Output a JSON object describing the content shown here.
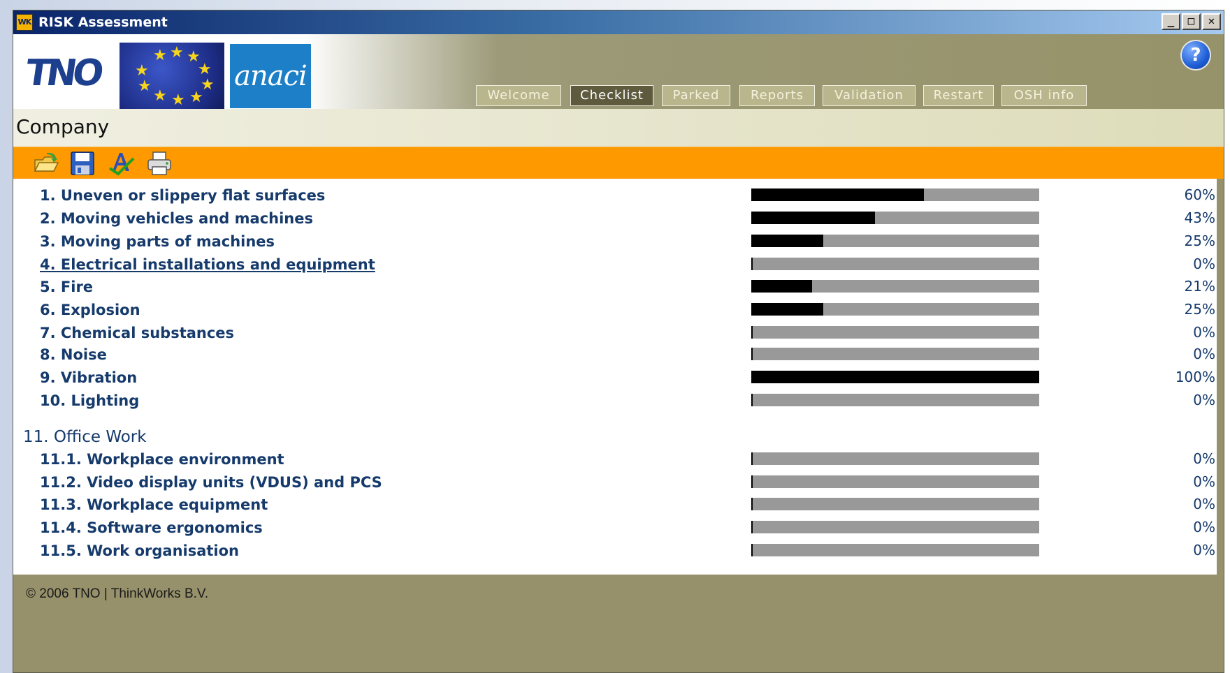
{
  "window": {
    "title": "RISK Assessment",
    "app_icon": "WK",
    "minimize": "_",
    "maximize": "□",
    "close": "✕"
  },
  "banner": {
    "tno_logo_text": "TNO",
    "anaci_logo_text": "anaci",
    "help_label": "?"
  },
  "tabs": [
    {
      "label": "Welcome",
      "active": false
    },
    {
      "label": "Checklist",
      "active": true
    },
    {
      "label": "Parked",
      "active": false
    },
    {
      "label": "Reports",
      "active": false
    },
    {
      "label": "Validation",
      "active": false
    },
    {
      "label": "Restart",
      "active": false
    },
    {
      "label": "OSH info",
      "active": false
    }
  ],
  "page": {
    "title": "Company"
  },
  "toolbar": {
    "icons": [
      "open-folder-icon",
      "save-icon",
      "spell-check-icon",
      "print-icon"
    ]
  },
  "checklist": {
    "items": [
      {
        "label": "1. Uneven or slippery flat surfaces",
        "percent": "60%",
        "progress": 0.6
      },
      {
        "label": "2. Moving vehicles and machines",
        "percent": "43%",
        "progress": 0.43
      },
      {
        "label": "3. Moving parts of machines",
        "percent": "25%",
        "progress": 0.25
      },
      {
        "label": "4. Electrical installations and equipment",
        "percent": "0%",
        "progress": 0,
        "link": true
      },
      {
        "label": "5. Fire",
        "percent": "21%",
        "progress": 0.21
      },
      {
        "label": "6. Explosion",
        "percent": "25%",
        "progress": 0.25
      },
      {
        "label": "7. Chemical substances",
        "percent": "0%",
        "progress": 0
      },
      {
        "label": "8. Noise",
        "percent": "0%",
        "progress": 0
      },
      {
        "label": "9. Vibration",
        "percent": "100%",
        "progress": 1.0
      },
      {
        "label": "10. Lighting",
        "percent": "0%",
        "progress": 0
      }
    ],
    "section_heading": "11. Office Work",
    "sub_items": [
      {
        "label": "11.1. Workplace environment",
        "percent": "0%",
        "progress": 0
      },
      {
        "label": "11.2. Video display units (VDUS) and PCS",
        "percent": "0%",
        "progress": 0
      },
      {
        "label": "11.3. Workplace equipment",
        "percent": "0%",
        "progress": 0
      },
      {
        "label": "11.4. Software ergonomics",
        "percent": "0%",
        "progress": 0
      },
      {
        "label": "11.5. Work organisation",
        "percent": "0%",
        "progress": 0
      }
    ]
  },
  "footer": {
    "copyright": "© 2006 TNO | ThinkWorks B.V."
  }
}
